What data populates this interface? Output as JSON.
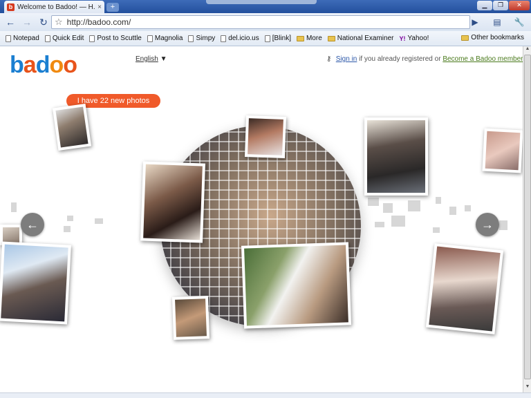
{
  "browser": {
    "tab_title": "Welcome to Badoo! — H...",
    "tab_favicon": "b",
    "tab_close": "×",
    "new_tab": "+",
    "url": "http://badoo.com/",
    "nav": {
      "back": "←",
      "forward": "→",
      "reload": "↻",
      "star": "☆"
    },
    "toolbar_icons": {
      "go": "▶",
      "page": "▤",
      "wrench": "🔧"
    },
    "window_buttons": {
      "minimize": "▁",
      "maximize": "❐",
      "close": "✕"
    },
    "bookmarks": [
      {
        "label": "Notepad",
        "icon": "page-icon"
      },
      {
        "label": "Quick Edit",
        "icon": "page-icon"
      },
      {
        "label": "Post to Scuttle",
        "icon": "page-icon"
      },
      {
        "label": "Magnolia",
        "icon": "page-icon"
      },
      {
        "label": "Simpy",
        "icon": "page-icon"
      },
      {
        "label": "del.icio.us",
        "icon": "page-icon"
      },
      {
        "label": "[Blink]",
        "icon": "page-icon"
      },
      {
        "label": "More",
        "icon": "folder-icon"
      },
      {
        "label": "National Examiner",
        "icon": "folder-icon"
      },
      {
        "label": "Yahoo!",
        "icon": "yahoo-icon"
      }
    ],
    "other_bookmarks": "Other bookmarks"
  },
  "page": {
    "logo_letters": [
      "b",
      "a",
      "d",
      "o",
      "o"
    ],
    "language": "English",
    "language_caret": "▼",
    "signin_link": "Sign in",
    "signin_text": " if you already registered or ",
    "member_link": "Become a Badoo member",
    "bubble": "I have 22 new photos",
    "arrow_left": "←",
    "arrow_right": "→"
  }
}
